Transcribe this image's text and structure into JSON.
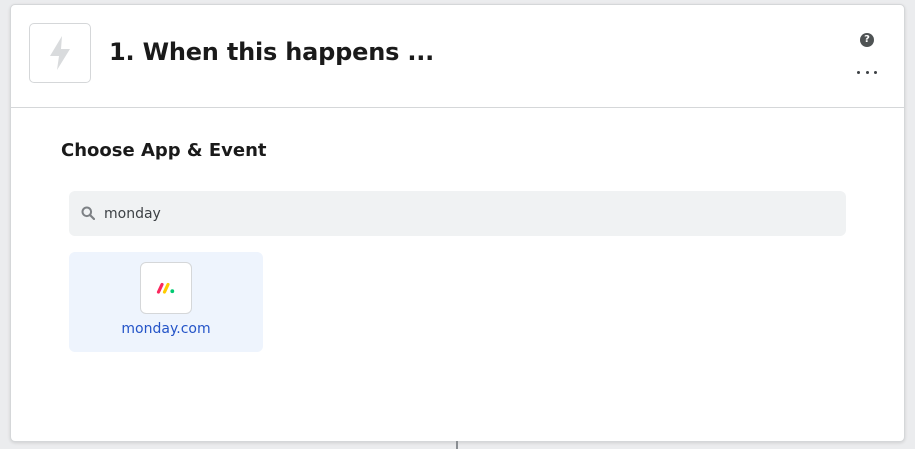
{
  "step": {
    "title": "1. When this happens ...",
    "trigger_icon": "lightning-bolt-icon"
  },
  "header_actions": {
    "help_icon": "question-circle-icon",
    "help_glyph": "?",
    "more_icon": "ellipsis-icon"
  },
  "section": {
    "title": "Choose App & Event"
  },
  "search": {
    "icon": "search-icon",
    "value": "monday"
  },
  "results": [
    {
      "name": "monday.com",
      "icon": "monday-com-logo-icon"
    }
  ],
  "colors": {
    "app_name_link": "#2454c8",
    "result_background": "#eef4fd",
    "search_background": "#f0f2f3",
    "monday_red": "#fb275d",
    "monday_yellow": "#ffcc00",
    "monday_green": "#00ca72"
  }
}
